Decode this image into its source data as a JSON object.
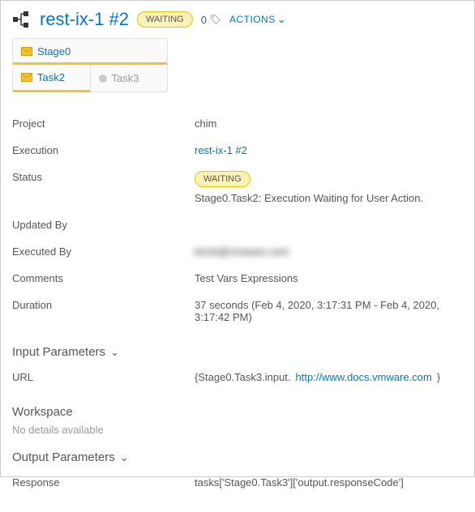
{
  "header": {
    "title": "rest-ix-1 #2",
    "status_badge": "WAITING",
    "count": "0",
    "actions_label": "ACTIONS"
  },
  "stage": {
    "name": "Stage0",
    "tasks": [
      {
        "name": "Task2",
        "state": "active"
      },
      {
        "name": "Task3",
        "state": "idle"
      }
    ]
  },
  "details": {
    "project_label": "Project",
    "project_value": "chim",
    "execution_label": "Execution",
    "execution_value": "rest-ix-1 #2",
    "status_label": "Status",
    "status_badge": "WAITING",
    "status_text": "Stage0.Task2: Execution Waiting for User Action.",
    "updated_by_label": "Updated By",
    "updated_by_value": "",
    "executed_by_label": "Executed By",
    "executed_by_value": "kerrb@vmware.com",
    "comments_label": "Comments",
    "comments_value": "Test Vars Expressions",
    "duration_label": "Duration",
    "duration_value": "37 seconds (Feb 4, 2020, 3:17:31 PM - Feb 4, 2020, 3:17:42 PM)"
  },
  "input_params": {
    "header": "Input Parameters",
    "url_label": "URL",
    "url_prefix": "{Stage0.Task3.input.",
    "url_link": "http://www.docs.vmware.com",
    "url_suffix": "}"
  },
  "workspace": {
    "header": "Workspace",
    "subtext": "No details available"
  },
  "output_params": {
    "header": "Output Parameters",
    "response_label": "Response",
    "response_value": "tasks['Stage0.Task3']['output.responseCode']"
  }
}
